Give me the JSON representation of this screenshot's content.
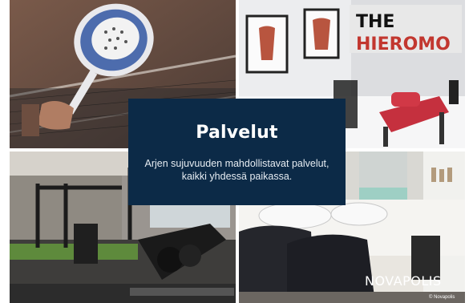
{
  "card": {
    "title": "Palvelut",
    "line1": "Arjen sujuvuuden mahdollistavat palvelut,",
    "line2": "kaikki yhdessä paikassa."
  },
  "sign": {
    "line1": "THE",
    "line2": "HIEROMO"
  },
  "brand": {
    "logo_text": "NOVAPOLIS",
    "copyright": "© Novapolis"
  },
  "colors": {
    "card_bg": "#0c2a47",
    "sign_red": "#c2372f",
    "text": "#ffffff"
  },
  "icons": {
    "padel": "padel-racket-photo",
    "massage": "massage-room-photo",
    "gym": "gym-photo",
    "salon": "hair-salon-photo"
  }
}
